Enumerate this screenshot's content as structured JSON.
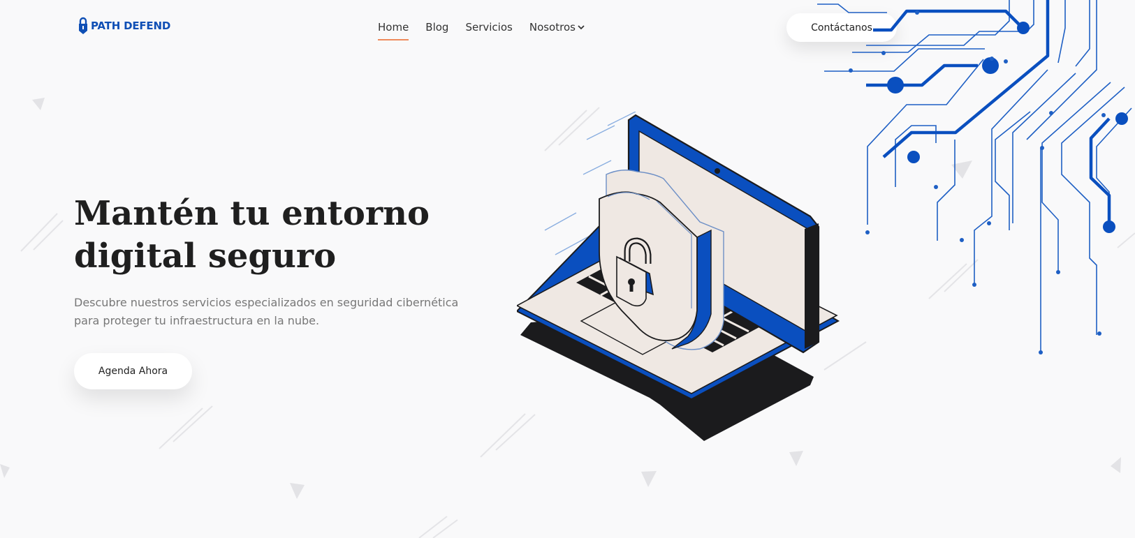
{
  "brand": {
    "name": "PATH DEFEND",
    "color": "#0f4fb5",
    "logo_icon": "shield-lock-icon"
  },
  "nav": {
    "items": [
      {
        "label": "Home",
        "active": true
      },
      {
        "label": "Blog",
        "active": false
      },
      {
        "label": "Servicios",
        "active": false
      },
      {
        "label": "Nosotros",
        "active": false,
        "has_dropdown": true
      }
    ],
    "active_underline_color": "#ef8a5b"
  },
  "header": {
    "contact_label": "Contáctanos"
  },
  "hero": {
    "title_line1": "Mantén tu entorno",
    "title_line2": "digital seguro",
    "subtitle_line1": "Descubre nuestros servicios especializados en seguridad cibernética",
    "subtitle_line2": "para proteger tu infraestructura en la nube.",
    "cta_label": "Agenda Ahora"
  },
  "illustration": {
    "name": "laptop-shield-lock-illustration",
    "accent": "#0a4fbf"
  },
  "decor": {
    "circuit_color": "#0a4fbf",
    "background": "#f9f9fa"
  }
}
